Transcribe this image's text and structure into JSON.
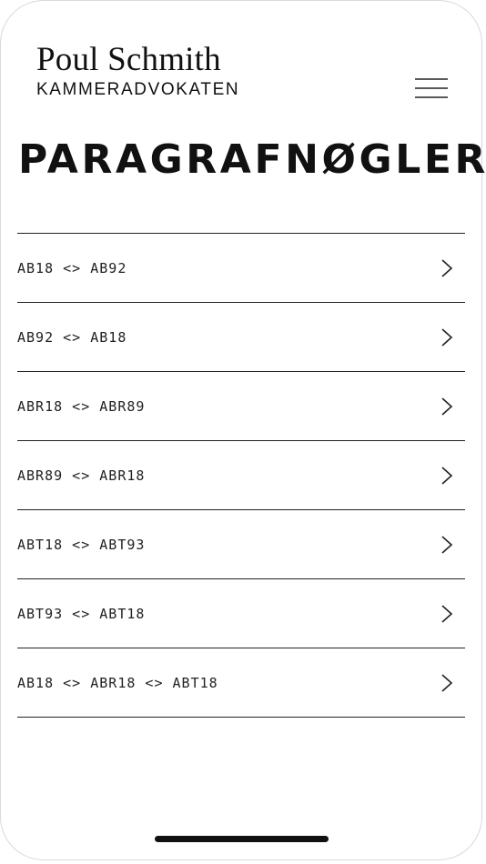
{
  "brand": {
    "name": "Poul Schmith",
    "subtitle": "KAMMERADVOKATEN"
  },
  "header": {
    "menu_icon": "hamburger-menu-icon"
  },
  "page": {
    "title": "PARAGRAFNØGLER"
  },
  "keys": [
    {
      "label": "AB18 <> AB92"
    },
    {
      "label": "AB92 <> AB18"
    },
    {
      "label": "ABR18 <> ABR89"
    },
    {
      "label": "ABR89 <> ABR18"
    },
    {
      "label": "ABT18 <> ABT93"
    },
    {
      "label": "ABT93 <> ABT18"
    },
    {
      "label": "AB18 <> ABR18 <> ABT18"
    }
  ],
  "colors": {
    "text": "#111111",
    "divider": "#222222",
    "background": "#ffffff"
  }
}
